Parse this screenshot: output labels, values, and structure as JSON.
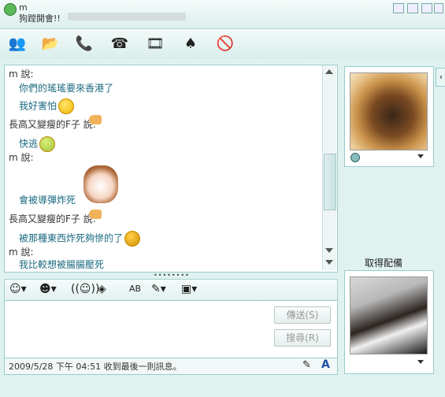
{
  "title": {
    "name": "m",
    "subtitle": "狗蹚開會!!"
  },
  "messages": [
    {
      "type": "header",
      "text": "m 說:"
    },
    {
      "type": "text",
      "text": "你們的瑤瑤要來香港了"
    },
    {
      "type": "text",
      "text": "我好害怕"
    },
    {
      "type": "header",
      "text": "長高又變瘦的F子 說:"
    },
    {
      "type": "text",
      "text": "快逃"
    },
    {
      "type": "header",
      "text": "m 說:"
    },
    {
      "type": "text",
      "text": "會被導彈炸死"
    },
    {
      "type": "header",
      "text": "長高又變瘦的F子 說:"
    },
    {
      "type": "text",
      "text": "被那種東西炸死夠慘的了"
    },
    {
      "type": "header",
      "text": "m 說:"
    },
    {
      "type": "text",
      "text": "我比較想被腸腸壓死"
    }
  ],
  "buttons": {
    "send": "傳送(S)",
    "search": "搜尋(R)"
  },
  "status": "2009/5/28 下午 04:51 收到最後一則訊息。",
  "right_panel": {
    "get_label": "取得配備"
  },
  "colors": {
    "accent": "#1a6a80",
    "bg": "#dff2f0"
  }
}
